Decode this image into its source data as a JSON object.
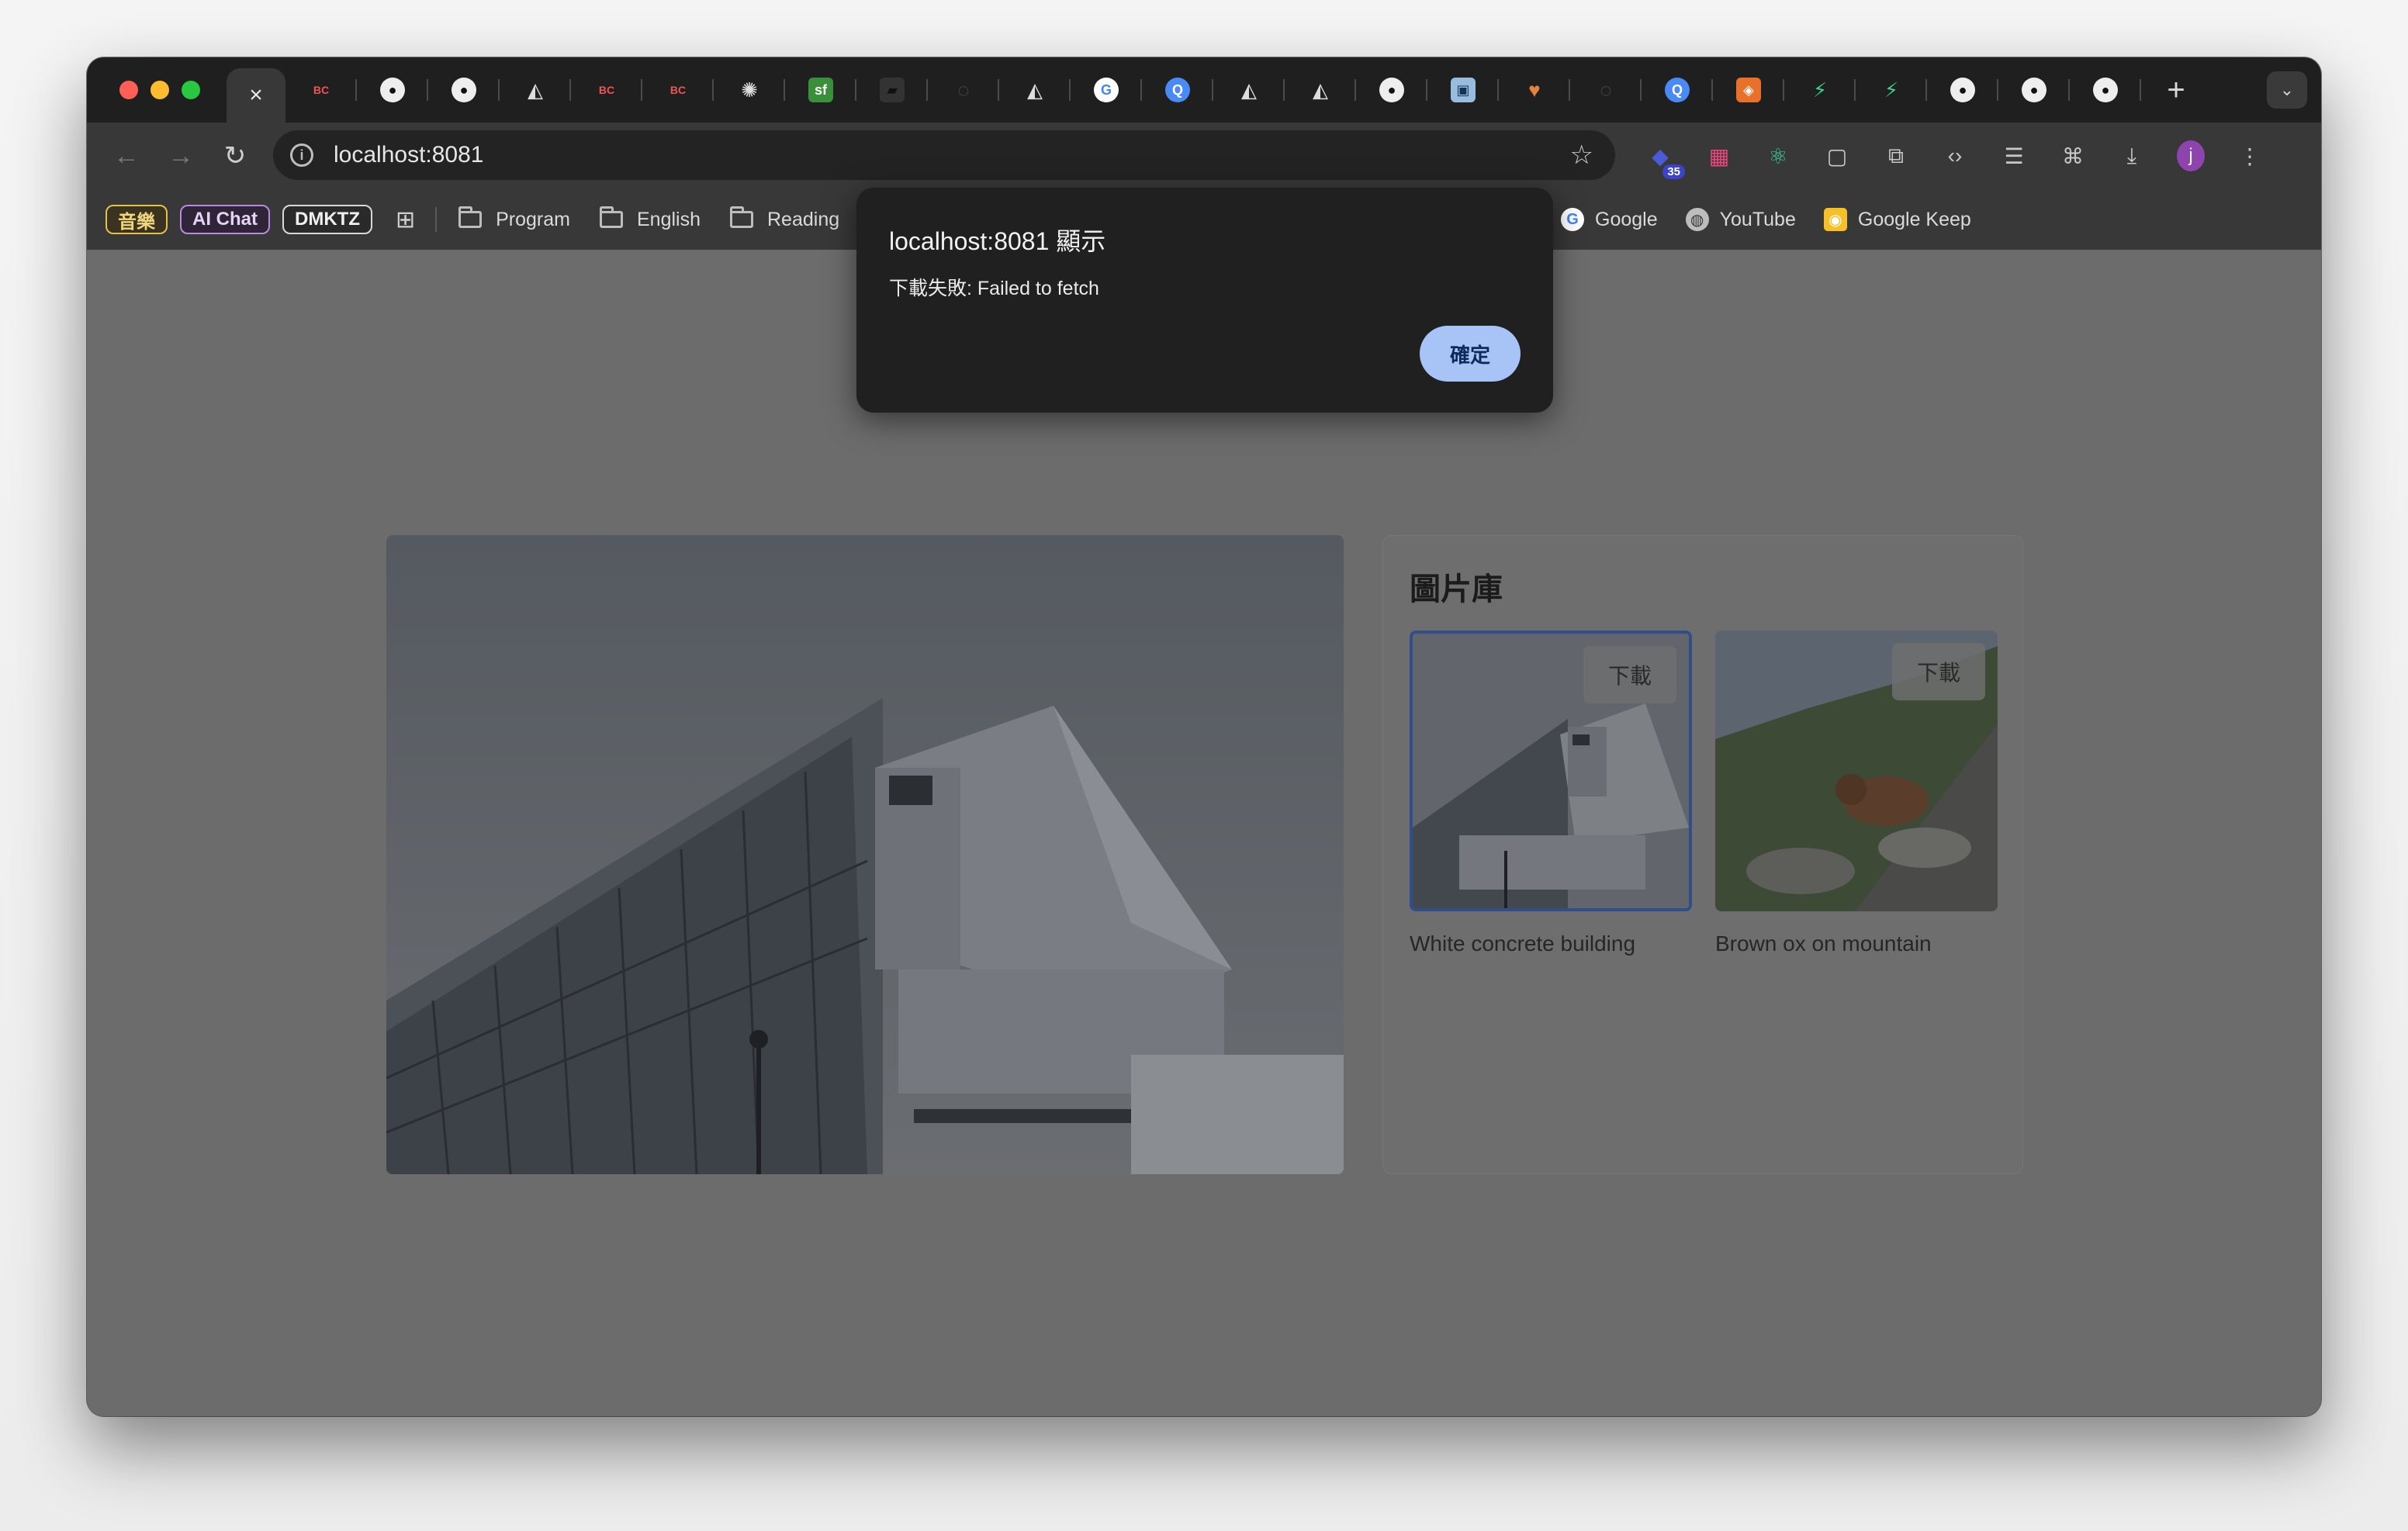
{
  "browser": {
    "close_tab_glyph": "×",
    "new_tab_glyph": "+",
    "tab_menu_glyph": "⌄",
    "url": "localhost:8081",
    "extension_badge": "35",
    "avatar_letter": "j"
  },
  "bookmarks": {
    "chips": [
      "音樂",
      "AI Chat",
      "DMKTZ"
    ],
    "folders": [
      "Program",
      "English",
      "Reading"
    ],
    "links": [
      "Google",
      "YouTube",
      "Google Keep"
    ]
  },
  "gallery": {
    "title": "圖片庫",
    "items": [
      {
        "caption": "White concrete building",
        "button": "下載"
      },
      {
        "caption": "Brown ox on mountain",
        "button": "下載"
      }
    ]
  },
  "dialog": {
    "title": "localhost:8081 顯示",
    "message": "下載失敗: Failed to fetch",
    "ok_label": "確定"
  },
  "colors": {
    "traffic_red": "#ff5f57",
    "traffic_yellow": "#febc2e",
    "traffic_green": "#28c840",
    "dialog_button": "#a8c3f6",
    "selected_border": "#2f4e8a"
  }
}
